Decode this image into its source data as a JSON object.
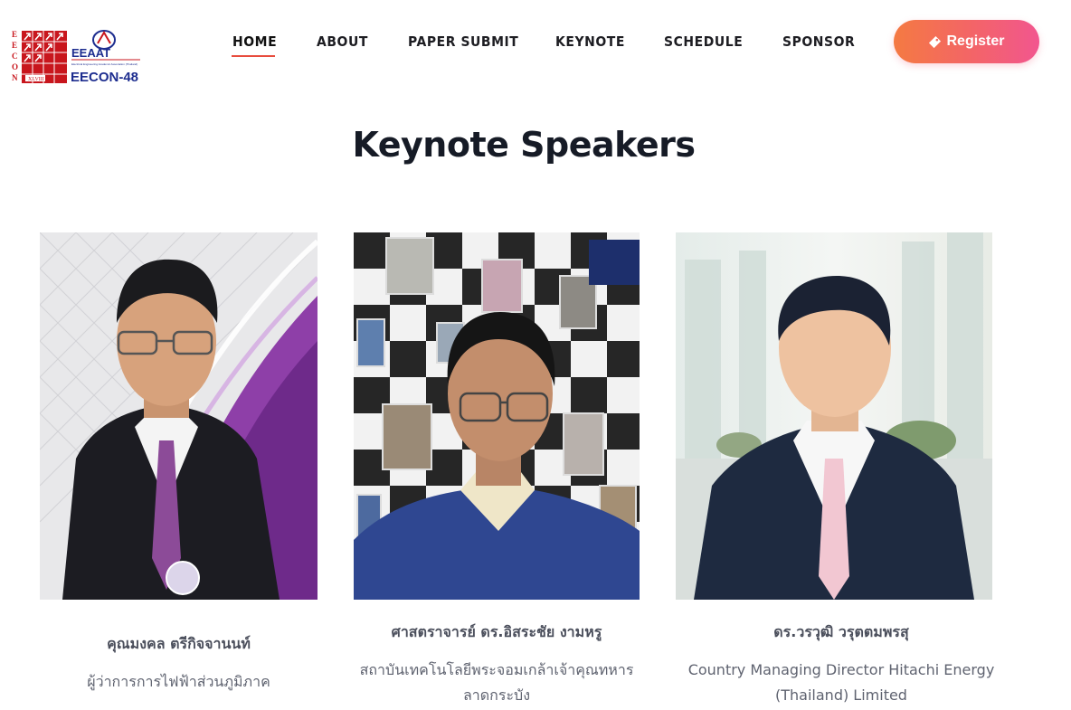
{
  "brand": {
    "logo_left_letters": "EECON",
    "logo_left_sub": "XLVIII",
    "logo_right_mark": "EEAAT",
    "logo_right_tag": "Electrical Engineering Academic Association (Thailand)",
    "logo_right_name": "EECON-48"
  },
  "nav": {
    "items": [
      {
        "label": "HOME",
        "active": true
      },
      {
        "label": "ABOUT"
      },
      {
        "label": "PAPER SUBMIT"
      },
      {
        "label": "KEYNOTE"
      },
      {
        "label": "SCHEDULE"
      },
      {
        "label": "SPONSOR"
      }
    ],
    "register_label": "Register",
    "register_icon": "ticket-icon"
  },
  "page": {
    "title": "Keynote Speakers"
  },
  "speakers": [
    {
      "name": "คุณมงคล ตรีกิจจานนท์",
      "role_lines": [
        "ผู้ว่าการการไฟฟ้าส่วนภูมิภาค"
      ],
      "photo_bg": "#9b4fb0"
    },
    {
      "name": "ศาสตราจารย์ ดร.อิสระชัย งามหรู",
      "role_lines": [
        "สถาบันเทคโนโลยีพระจอมเกล้าเจ้าคุณทหาร",
        "ลาดกระบัง"
      ],
      "photo_bg": "#2b2b2b"
    },
    {
      "name": "ดร.วรวุฒิ วรุตตมพรสุ",
      "role_lines": [
        "Country Managing Director Hitachi Energy",
        "(Thailand) Limited"
      ],
      "photo_bg": "#dfe9e6"
    }
  ],
  "colors": {
    "accent": "#e84c3d",
    "register_gradient_start": "#f47a42",
    "register_gradient_end": "#f2568f",
    "title": "#161b26"
  }
}
